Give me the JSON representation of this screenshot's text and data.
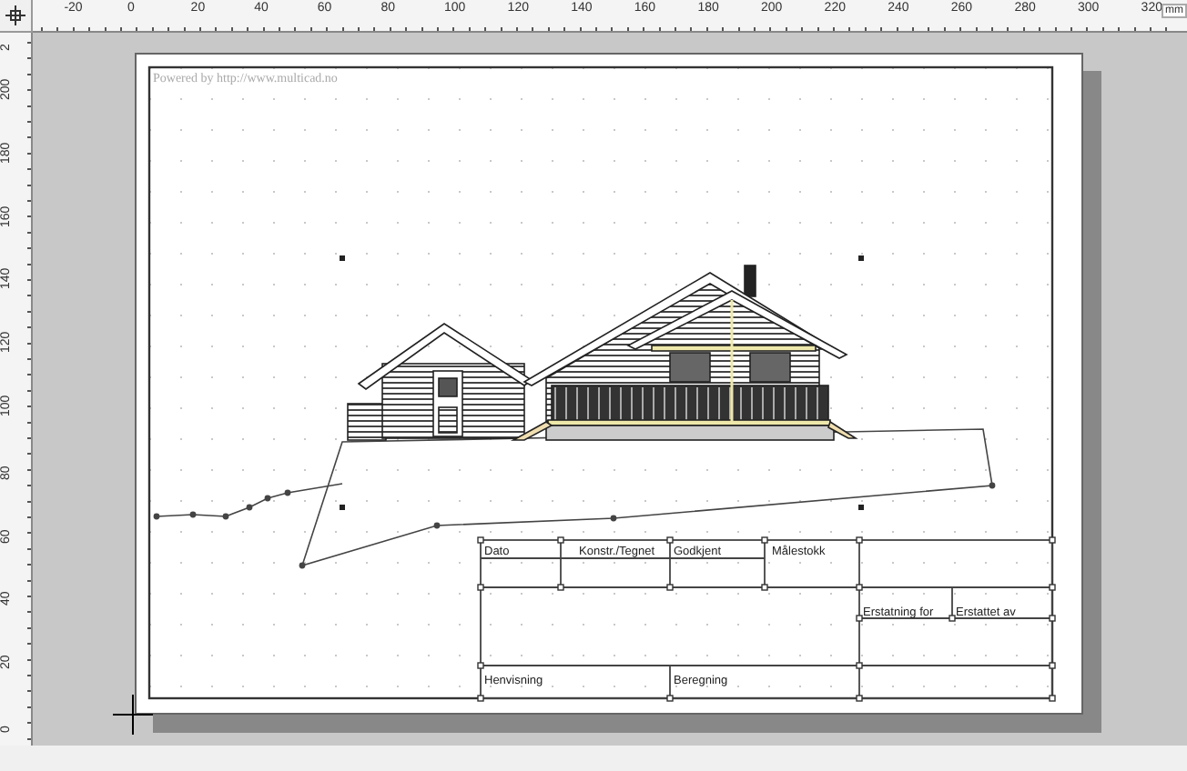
{
  "rulers": {
    "top_labels": [
      "-20",
      "0",
      "20",
      "40",
      "60",
      "80",
      "100",
      "120",
      "140",
      "160",
      "180",
      "200",
      "220",
      "240",
      "260",
      "280",
      "300",
      "320"
    ],
    "unit": "mm",
    "left_labels": [
      "2",
      "200",
      "180",
      "160",
      "140",
      "120",
      "100",
      "80",
      "60",
      "40",
      "20",
      "0"
    ]
  },
  "drawing": {
    "watermark": "Powered by http://www.multicad.no"
  },
  "title_block": {
    "fields": [
      "Dato",
      "Konstr./Tegnet",
      "Godkjent",
      "Målestokk",
      "Erstatning for",
      "Erstattet av",
      "Henvisning",
      "Beregning"
    ]
  }
}
